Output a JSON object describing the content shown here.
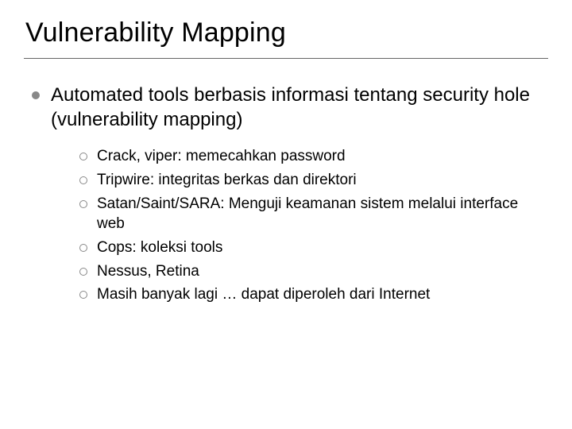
{
  "title": "Vulnerability Mapping",
  "level1": {
    "text": "Automated tools berbasis informasi tentang security hole (vulnerability mapping)"
  },
  "level2": [
    {
      "text": "Crack, viper: memecahkan password"
    },
    {
      "text": "Tripwire: integritas berkas dan direktori"
    },
    {
      "text": "Satan/Saint/SARA: Menguji keamanan sistem melalui interface web"
    },
    {
      "text": "Cops: koleksi tools"
    },
    {
      "text": "Nessus, Retina"
    },
    {
      "text": "Masih banyak lagi … dapat diperoleh dari Internet"
    }
  ]
}
